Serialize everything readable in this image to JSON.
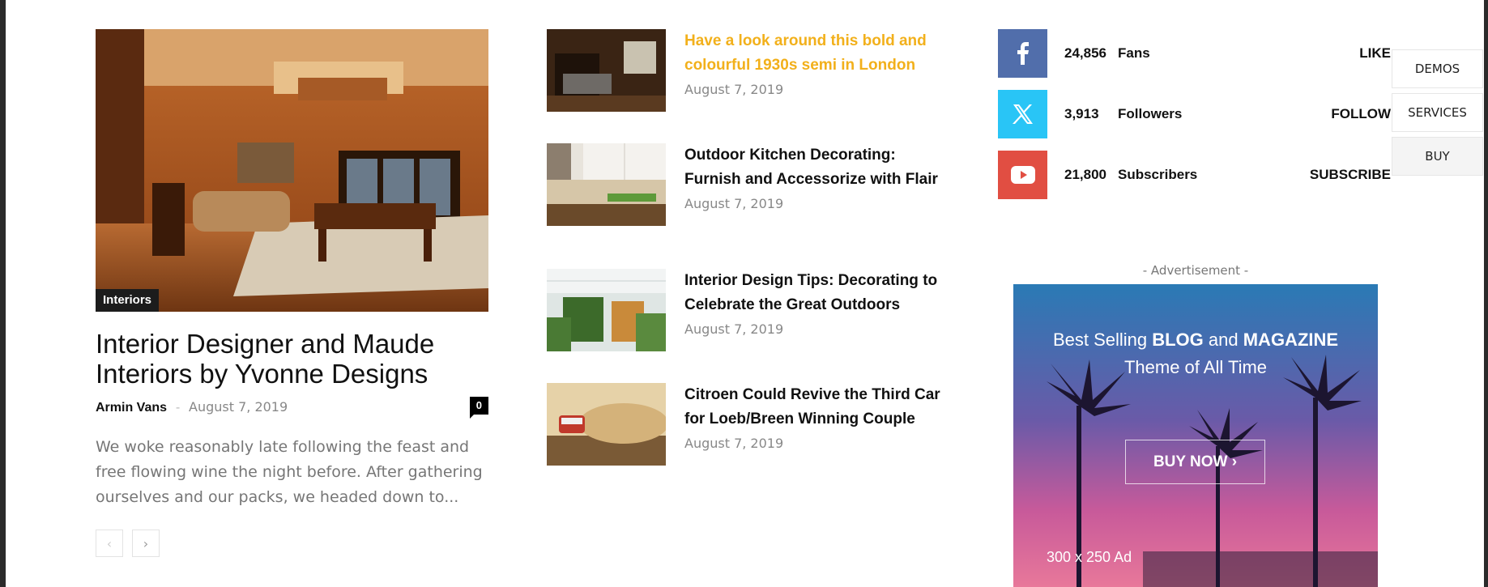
{
  "featured": {
    "category": "Interiors",
    "title": "Interior Designer and Maude Interiors by Yvonne Designs",
    "author": "Armin Vans",
    "separator": "-",
    "date": "August 7, 2019",
    "comments": "0",
    "excerpt": "We woke reasonably late following the feast and free flowing wine the night before. After gathering ourselves and our packs, we headed down to..."
  },
  "pager": {
    "prev": "‹",
    "next": "›"
  },
  "posts": [
    {
      "title": "Have a look around this bold and colourful 1930s semi in London",
      "date": "August 7, 2019",
      "highlight_color": "#f2b01b"
    },
    {
      "title": "Outdoor Kitchen Decorating: Furnish and Accessorize with Flair",
      "date": "August 7, 2019"
    },
    {
      "title": "Interior Design Tips: Decorating to Celebrate the Great Outdoors",
      "date": "August 7, 2019"
    },
    {
      "title": "Citroen Could Revive the Third Car for Loeb/Breen Winning Couple",
      "date": "August 7, 2019"
    }
  ],
  "social": [
    {
      "network": "facebook",
      "icon": "facebook-icon",
      "color": "#516eab",
      "count": "24,856",
      "label": "Fans",
      "action": "LIKE"
    },
    {
      "network": "twitter",
      "icon": "x-twitter-icon",
      "color": "#29c5f6",
      "count": "3,913",
      "label": "Followers",
      "action": "FOLLOW"
    },
    {
      "network": "youtube",
      "icon": "youtube-icon",
      "color": "#e14e42",
      "count": "21,800",
      "label": "Subscribers",
      "action": "SUBSCRIBE"
    }
  ],
  "side_buttons": [
    "DEMOS",
    "SERVICES",
    "BUY"
  ],
  "ad": {
    "label": "- Advertisement -",
    "headline_1": "Best Selling ",
    "headline_bold_1": "BLOG",
    "headline_2": " and ",
    "headline_bold_2": "MAGAZINE",
    "headline_line2": "Theme of All Time",
    "button": "BUY NOW ›",
    "size": "300 x 250 Ad"
  }
}
